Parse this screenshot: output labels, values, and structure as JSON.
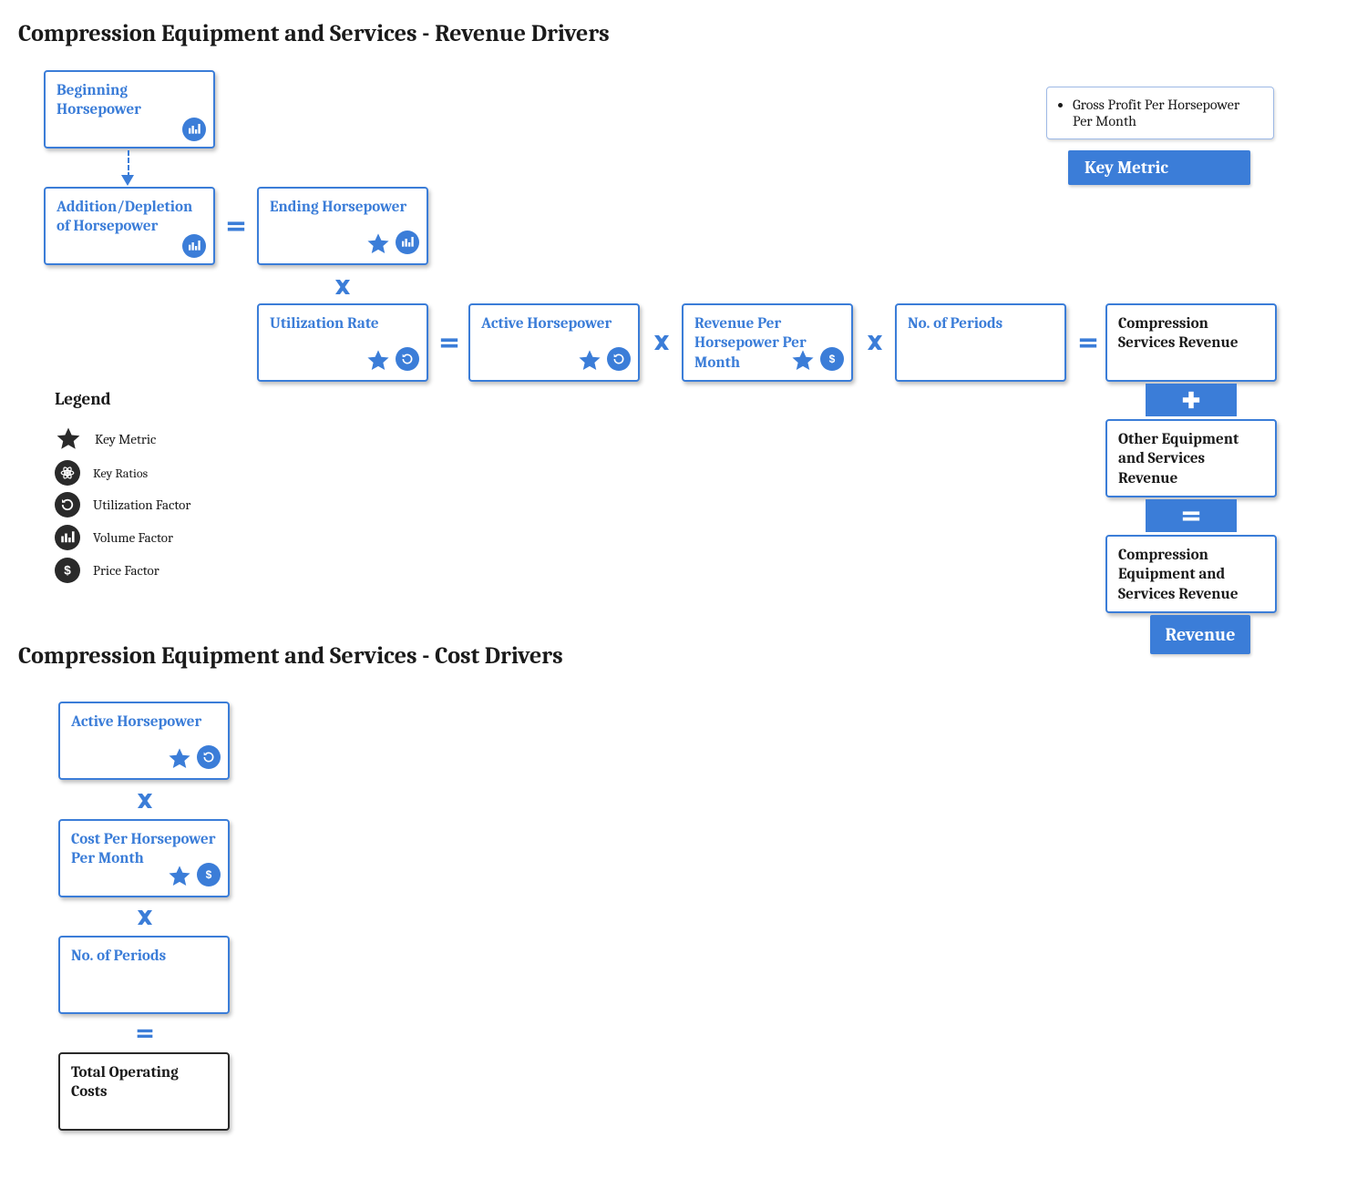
{
  "title1": "Compression Equipment and Services - Revenue Drivers",
  "title2": "Compression Equipment and Services - Cost Drivers",
  "callout": {
    "item1": "Gross Profit Per Horsepower Per Month",
    "label": "Key Metric"
  },
  "boxes": {
    "beginning_hp": "Beginning Horsepower",
    "add_depl_hp": "Addition/Depletion of Horsepower",
    "ending_hp": "Ending Horsepower",
    "util_rate": "Utilization Rate",
    "active_hp": "Active  Horsepower",
    "rev_per_hp": "Revenue Per Horsepower Per Month",
    "periods": "No. of Periods",
    "comp_serv_rev": "Compression Services Revenue",
    "other_rev": "Other Equipment and Services Revenue",
    "total_rev": "Compression Equipment and Services Revenue",
    "revenue_label": "Revenue",
    "c_active_hp": "Active Horsepower",
    "c_cost_per_hp": "Cost Per Horsepower Per Month",
    "c_periods": "No. of Periods",
    "c_total": "Total Operating Costs"
  },
  "legend": {
    "title": "Legend",
    "key_metric": "Key Metric",
    "key_ratios": "Key Ratios",
    "util_factor": "Utilization Factor",
    "vol_factor": "Volume Factor",
    "price_factor": "Price Factor"
  },
  "icons": {
    "star": "star-icon",
    "volume": "bar-chart-icon",
    "util": "refresh-circle-icon",
    "price": "dollar-icon",
    "ratios": "atom-icon"
  },
  "colors": {
    "blue": "#3b7dd8",
    "dark": "#2a2a2a"
  }
}
